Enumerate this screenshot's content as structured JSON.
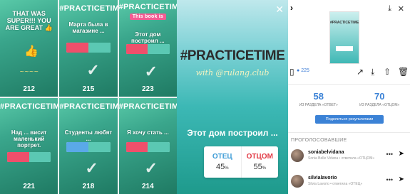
{
  "thumbnails": [
    {
      "header": "THAT WAS SUPER!!! YOU ARE GREAT 👍",
      "badge": "",
      "lines": [],
      "count": "212"
    },
    {
      "header": "#PRACTICETIME",
      "badge": "",
      "lines": [
        "Марта была в магазине ..."
      ],
      "count": "215"
    },
    {
      "header": "#PRACTICETIME",
      "badge": "This book is",
      "lines": [
        "Этот дом построил ..."
      ],
      "count": "223"
    },
    {
      "header": "#PRACTICETIME",
      "badge": "",
      "lines": [
        "Над ... висит маленький портрет."
      ],
      "count": "221"
    },
    {
      "header": "#PRACTICETIME",
      "badge": "",
      "lines": [
        "Студенты любят ..."
      ],
      "count": "218"
    },
    {
      "header": "#PRACTICETIME",
      "badge": "",
      "lines": [
        "Я хочу стать ..."
      ],
      "count": "214"
    }
  ],
  "story": {
    "close_icon": "close-icon",
    "hashtag": "#PRACTICETIME",
    "handle": "with @rulang.club",
    "phrase": "Этот дом построил ...",
    "poll": [
      {
        "label": "ОТЕЦ",
        "percent": "45",
        "color": "#3b9bd6"
      },
      {
        "label": "ОТЦОМ",
        "percent": "55",
        "color": "#e23a45"
      }
    ]
  },
  "panel": {
    "views_label": "225",
    "stats": [
      {
        "value": "58",
        "label": "ИЗ РАЗДЕЛА «ОТВЕТ»"
      },
      {
        "value": "70",
        "label": "ИЗ РАЗДЕЛА «ОТЦОМ»"
      }
    ],
    "promote_label": "Поделиться результатами",
    "viewers_header": "ПРОГОЛОСОВАВШИЕ",
    "viewers": [
      {
        "name": "soniabelvidana",
        "desc": "Sonia Belle Vidana • ответила «ОТЦОМ»"
      },
      {
        "name": "silvialavorio",
        "desc": "Silvia Lavorio • ответила «ОТЕЦ»"
      }
    ]
  }
}
